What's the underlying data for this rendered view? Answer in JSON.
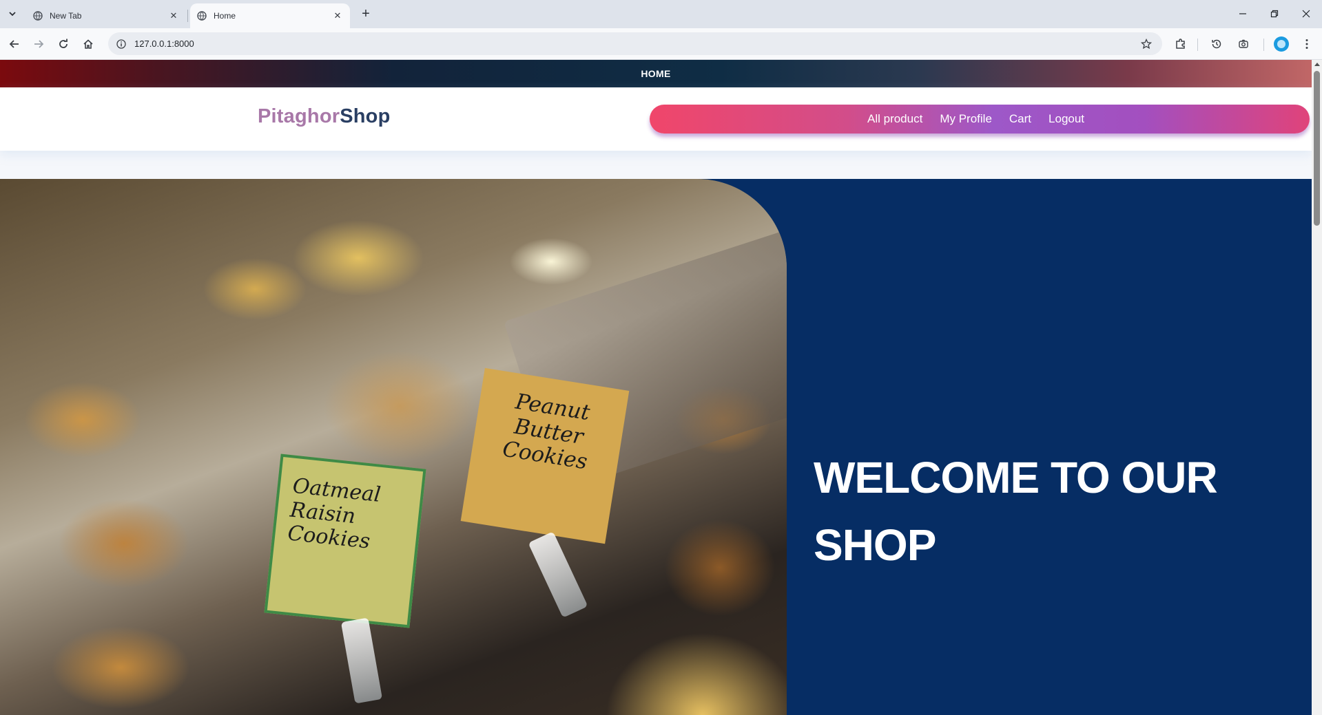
{
  "browser": {
    "tabs": [
      {
        "title": "New Tab",
        "active": false
      },
      {
        "title": "Home",
        "active": true
      }
    ],
    "url": "127.0.0.1:8000",
    "icons": {
      "tab_list": "chevron-down-icon",
      "new_tab": "plus-icon",
      "back": "arrow-left-icon",
      "forward": "arrow-right-icon",
      "reload": "reload-icon",
      "home": "home-icon",
      "site_info": "info-icon",
      "bookmark": "star-icon",
      "extensions": "puzzle-icon",
      "history": "history-icon",
      "screenshot": "camera-icon",
      "profile": "avatar",
      "menu": "kebab-menu-icon"
    }
  },
  "site": {
    "topbar_link": "HOME",
    "brand": {
      "part1": "Pitaghor",
      "part2": "Shop"
    },
    "nav": [
      "All product",
      "My Profile",
      "Cart",
      "Logout"
    ],
    "hero": {
      "title": "WELCOME TO OUR SHOP",
      "image_signs": {
        "left": "Oatmeal Raisin Cookies",
        "right": "Peanut Butter Cookies"
      }
    },
    "colors": {
      "brand_part1": "#a878a8",
      "brand_part2": "#2a3f63",
      "hero_bg": "#062d64",
      "nav_pill_start": "#f0466a",
      "nav_pill_mid": "#9d58c8"
    }
  }
}
